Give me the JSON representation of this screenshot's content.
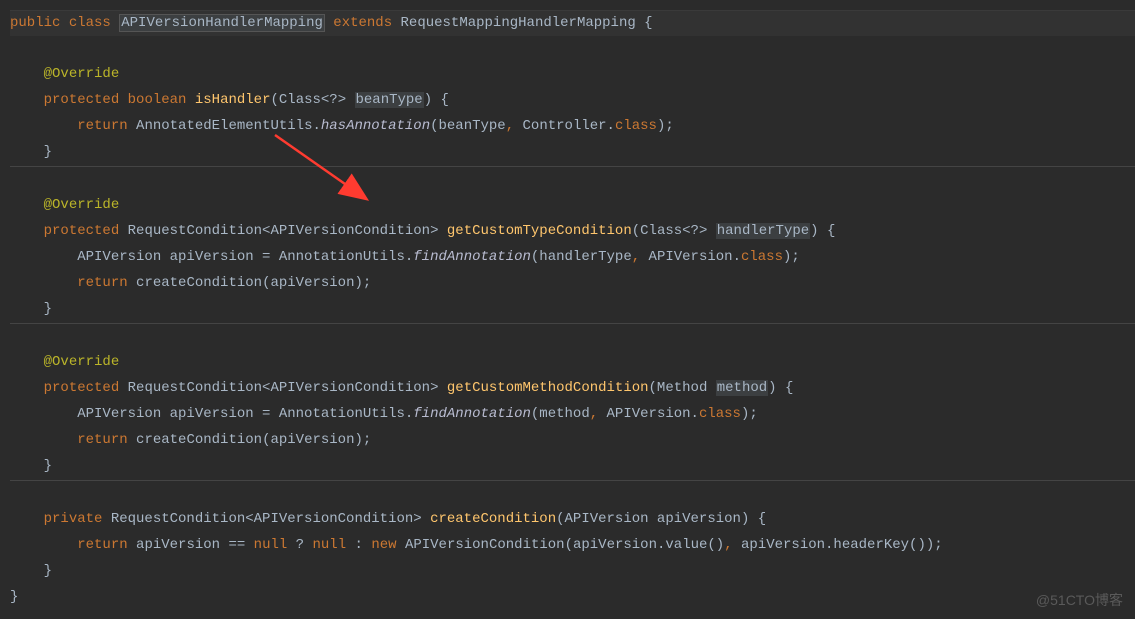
{
  "code": {
    "l1_public": "public",
    "l1_class": "class",
    "l1_classname": "APIVersionHandlerMapping",
    "l1_extends": "extends",
    "l1_parent": "RequestMappingHandlerMapping",
    "l1_brace": " {",
    "l3_override": "@Override",
    "l4_protected": "protected",
    "l4_boolean": "boolean",
    "l4_method": "isHandler",
    "l4_paramtype": "(Class<?> ",
    "l4_paramname": "beanType",
    "l4_after": ") {",
    "l5_return": "return",
    "l5_class1": " AnnotatedElementUtils.",
    "l5_method": "hasAnnotation",
    "l5_open": "(beanType",
    "l5_comma": ", ",
    "l5_controller": "Controller",
    "l5_dotclass": ".",
    "l5_classkw": "class",
    "l5_close": ");",
    "l6_brace": "}",
    "l8_override": "@Override",
    "l9_protected": "protected",
    "l9_rettype": " RequestCondition<APIVersionCondition> ",
    "l9_method": "getCustomTypeCondition",
    "l9_paramtype": "(Class<?> ",
    "l9_paramname": "handlerType",
    "l9_after": ") {",
    "l10_type": "APIVersion apiVersion = AnnotationUtils.",
    "l10_method": "findAnnotation",
    "l10_open": "(handlerType",
    "l10_comma": ", ",
    "l10_apiv": "APIVersion",
    "l10_dot": ".",
    "l10_classkw": "class",
    "l10_close": ");",
    "l11_return": "return",
    "l11_call": " createCondition(apiVersion);",
    "l12_brace": "}",
    "l14_override": "@Override",
    "l15_protected": "protected",
    "l15_rettype": " RequestCondition<APIVersionCondition> ",
    "l15_method": "getCustomMethodCondition",
    "l15_paramtype": "(Method ",
    "l15_paramname": "method",
    "l15_after": ") {",
    "l16_type": "APIVersion apiVersion = AnnotationUtils.",
    "l16_method": "findAnnotation",
    "l16_open": "(method",
    "l16_comma": ", ",
    "l16_apiv": "APIVersion",
    "l16_dot": ".",
    "l16_classkw": "class",
    "l16_close": ");",
    "l17_return": "return",
    "l17_call": " createCondition(apiVersion);",
    "l18_brace": "}",
    "l20_private": "private",
    "l20_rettype": " RequestCondition<APIVersionCondition> ",
    "l20_method": "createCondition",
    "l20_params": "(APIVersion apiVersion) {",
    "l21_return": "return",
    "l21_var": " apiVersion == ",
    "l21_null1": "null",
    "l21_q": " ? ",
    "l21_null2": "null",
    "l21_colon": " : ",
    "l21_new": "new",
    "l21_ctor": " APIVersionCondition(apiVersion.value()",
    "l21_comma": ", ",
    "l21_rest": "apiVersion.headerKey());",
    "l22_brace": "}",
    "l23_brace": "}"
  },
  "watermark": "@51CTO博客"
}
